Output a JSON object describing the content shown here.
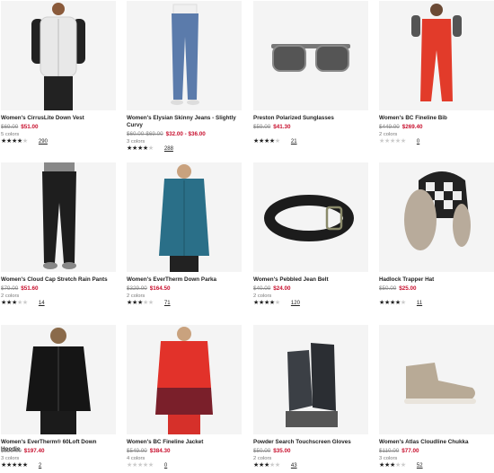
{
  "products": [
    {
      "title": "Women's CirrusLite Down Vest",
      "was": "$69.00",
      "now": "$51.00",
      "colors": "5 colors",
      "stars": 4,
      "reviews": "290",
      "icon": "down-vest"
    },
    {
      "title": "Women's Elysian Skinny Jeans - Slightly Curvy",
      "was": "$60.00-$69.00",
      "now": "$32.00 - $36.00",
      "colors": "3 colors",
      "stars": 4,
      "reviews": "288",
      "icon": "skinny-jeans"
    },
    {
      "title": "Preston Polarized Sunglasses",
      "was": "$59.00",
      "now": "$41.30",
      "colors": "",
      "stars": 4,
      "reviews": "21",
      "icon": "sunglasses"
    },
    {
      "title": "Women's BC Fineline Bib",
      "was": "$449.00",
      "now": "$269.40",
      "colors": "2 colors",
      "stars": 0,
      "reviews": "0",
      "icon": "ski-bib"
    },
    {
      "title": "Women's Cloud Cap Stretch Rain Pants",
      "was": "$79.00",
      "now": "$51.60",
      "colors": "2 colors",
      "stars": 3,
      "reviews": "14",
      "icon": "rain-pants"
    },
    {
      "title": "Women's EverTherm Down Parka",
      "was": "$329.00",
      "now": "$164.50",
      "colors": "2 colors",
      "stars": 3,
      "reviews": "71",
      "icon": "down-parka"
    },
    {
      "title": "Women's Pebbled Jean Belt",
      "was": "$40.00",
      "now": "$24.00",
      "colors": "2 colors",
      "stars": 4,
      "reviews": "120",
      "icon": "belt"
    },
    {
      "title": "Hadlock Trapper Hat",
      "was": "$50.00",
      "now": "$25.00",
      "colors": "",
      "stars": 4,
      "reviews": "11",
      "icon": "trapper-hat"
    },
    {
      "title": "Women's EverTherm® 60Loft Down Hoodie",
      "was": "$329.00",
      "now": "$197.40",
      "colors": "3 colors",
      "stars": 5,
      "reviews": "2",
      "icon": "down-hoodie"
    },
    {
      "title": "Women's BC Fineline Jacket",
      "was": "$549.00",
      "now": "$384.30",
      "colors": "4 colors",
      "stars": 0,
      "reviews": "0",
      "icon": "ski-jacket"
    },
    {
      "title": "Powder Search Touchscreen Gloves",
      "was": "$50.00",
      "now": "$35.00",
      "colors": "2 colors",
      "stars": 3,
      "reviews": "43",
      "icon": "gloves"
    },
    {
      "title": "Women's Atlas Cloudline Chukka",
      "was": "$110.00",
      "now": "$77.00",
      "colors": "3 colors",
      "stars": 3,
      "reviews": "52",
      "icon": "chukka-shoe"
    }
  ]
}
